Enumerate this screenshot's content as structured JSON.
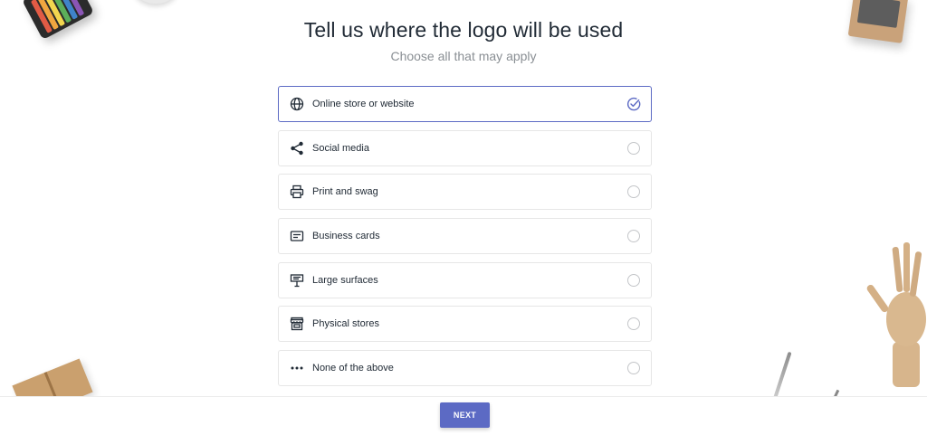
{
  "page": {
    "title": "Tell us where the logo will be used",
    "subtitle": "Choose all that may apply"
  },
  "options": [
    {
      "label": "Online store or website",
      "icon": "globe-icon",
      "selected": true
    },
    {
      "label": "Social media",
      "icon": "share-icon",
      "selected": false
    },
    {
      "label": "Print and swag",
      "icon": "printer-icon",
      "selected": false
    },
    {
      "label": "Business cards",
      "icon": "business-card-icon",
      "selected": false
    },
    {
      "label": "Large surfaces",
      "icon": "billboard-icon",
      "selected": false
    },
    {
      "label": "Physical stores",
      "icon": "storefront-icon",
      "selected": false
    },
    {
      "label": "None of the above",
      "icon": "more-dots-icon",
      "selected": false
    }
  ],
  "footer": {
    "next_label": "NEXT"
  },
  "colors": {
    "accent": "#5c6ac4",
    "text": "#212b36",
    "muted": "#8a8f94"
  }
}
